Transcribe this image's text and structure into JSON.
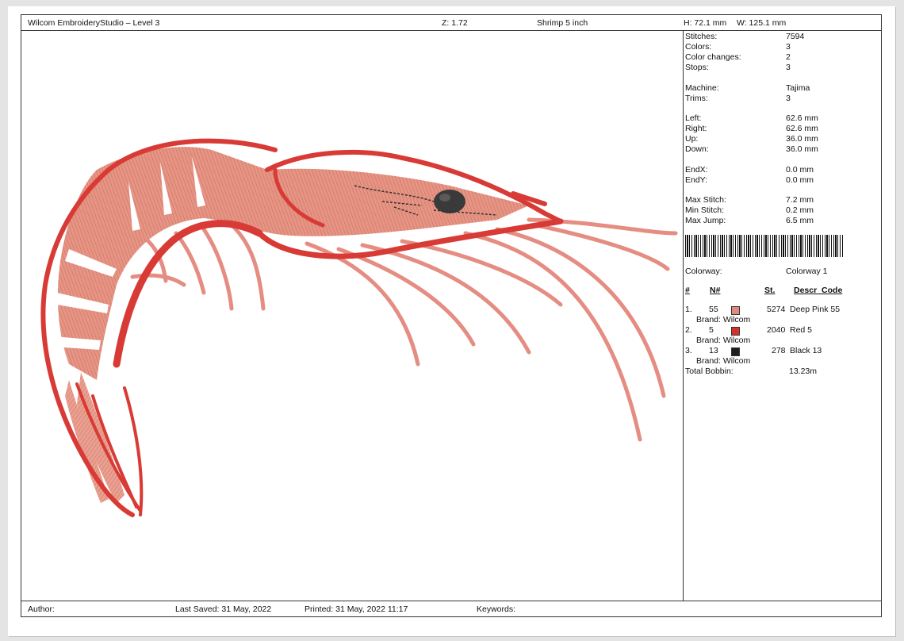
{
  "header": {
    "app_title": "Wilcom EmbroideryStudio – Level 3",
    "zoom": "Z: 1.72",
    "design_name": "Shrimp 5 inch",
    "height": "H: 72.1 mm",
    "width": "W: 125.1 mm"
  },
  "stats": [
    {
      "label": "Stitches:",
      "value": "7594"
    },
    {
      "label": "Colors:",
      "value": "3"
    },
    {
      "label": "Color changes:",
      "value": "2"
    },
    {
      "label": "Stops:",
      "value": "3"
    },
    {
      "label": "Machine:",
      "value": "Tajima"
    },
    {
      "label": "Trims:",
      "value": "3"
    },
    {
      "label": "Left:",
      "value": "62.6 mm"
    },
    {
      "label": "Right:",
      "value": "62.6 mm"
    },
    {
      "label": "Up:",
      "value": "36.0 mm"
    },
    {
      "label": "Down:",
      "value": "36.0 mm"
    },
    {
      "label": "EndX:",
      "value": "0.0 mm"
    },
    {
      "label": "EndY:",
      "value": "0.0 mm"
    },
    {
      "label": "Max Stitch:",
      "value": "7.2 mm"
    },
    {
      "label": "Min Stitch:",
      "value": "0.2 mm"
    },
    {
      "label": "Max Jump:",
      "value": "6.5 mm"
    }
  ],
  "colorway": {
    "label": "Colorway:",
    "value": "Colorway 1"
  },
  "color_table": {
    "headers": {
      "num": "#",
      "n": "N#",
      "st": "St.",
      "descr": "Descr_Code"
    },
    "rows": [
      {
        "idx": "1.",
        "n": "55",
        "color": "#e28a80",
        "st": "5274",
        "descr": "Deep Pink 55",
        "brand": "Brand: Wilcom"
      },
      {
        "idx": "2.",
        "n": "5",
        "color": "#d6302c",
        "st": "2040",
        "descr": "Red 5",
        "brand": "Brand: Wilcom"
      },
      {
        "idx": "3.",
        "n": "13",
        "color": "#1e1e1e",
        "st": "278",
        "descr": "Black 13",
        "brand": "Brand: Wilcom"
      }
    ],
    "total_bobbin_label": "Total Bobbin:",
    "total_bobbin_value": "13.23m"
  },
  "footer": {
    "author": "Author:",
    "last_saved": "Last Saved: 31 May, 2022",
    "printed": "Printed: 31 May, 2022 11:17",
    "keywords": "Keywords:"
  }
}
